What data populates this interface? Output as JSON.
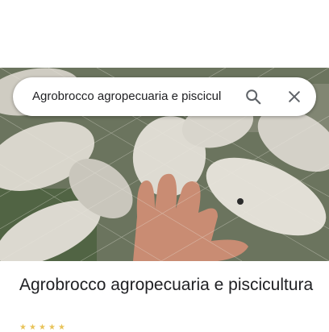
{
  "search": {
    "query": "Agrobrocco agropecuaria e piscicul",
    "search_icon": "search-icon",
    "close_icon": "close-icon"
  },
  "photo": {
    "subject": "photo-icon"
  },
  "place": {
    "name": "Agrobrocco agropecuaria e piscicultura"
  },
  "colors": {
    "text": "#202124",
    "icon": "#5f6368",
    "star": "#e8c35a"
  }
}
